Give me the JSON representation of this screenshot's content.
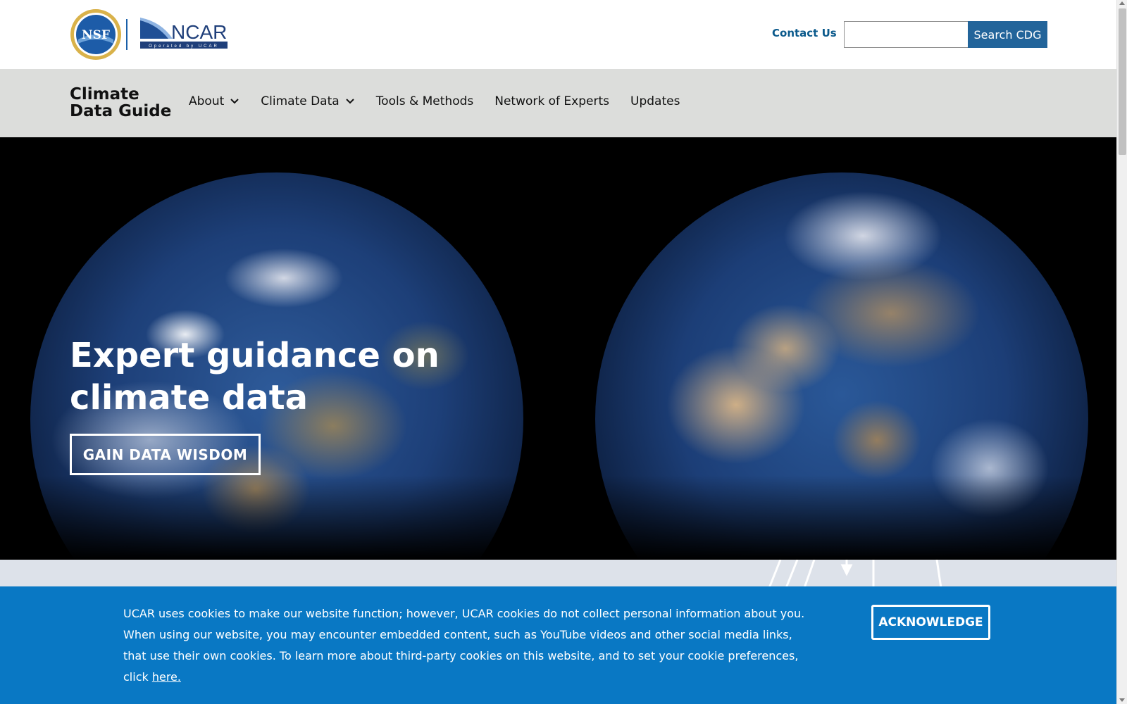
{
  "header": {
    "logos": {
      "nsf": {
        "text": "NSF",
        "icon": "nsf-seal-icon"
      },
      "ncar": {
        "text": "NCAR",
        "tagline": "Operated by UCAR",
        "icon": "ncar-logo-icon"
      }
    },
    "contact_label": "Contact Us",
    "search": {
      "value": "",
      "placeholder": "",
      "button_label": "Search CDG"
    }
  },
  "nav": {
    "site_title_line1": "Climate",
    "site_title_line2": "Data Guide",
    "items": [
      {
        "label": "About",
        "has_dropdown": true
      },
      {
        "label": "Climate Data",
        "has_dropdown": true
      },
      {
        "label": "Tools & Methods",
        "has_dropdown": false
      },
      {
        "label": "Network of Experts",
        "has_dropdown": false
      },
      {
        "label": "Updates",
        "has_dropdown": false
      }
    ]
  },
  "hero": {
    "title": "Expert guidance on climate data",
    "button_label": "GAIN DATA WISDOM"
  },
  "cookie_banner": {
    "text": "UCAR uses cookies to make our website function; however, UCAR cookies do not collect personal information about you. When using our website, you may encounter embedded content, such as YouTube videos and other social media links, that use their own cookies. To learn more about third-party cookies on this website, and to set your cookie preferences, click",
    "link_label": "here.",
    "button_label": "ACKNOWLEDGE"
  },
  "colors": {
    "brand_blue": "#22649a",
    "link_blue": "#0b5a8c",
    "cookie_blue": "#0978c4",
    "nav_bg": "#dcdddb",
    "hero_bg": "#000000"
  }
}
